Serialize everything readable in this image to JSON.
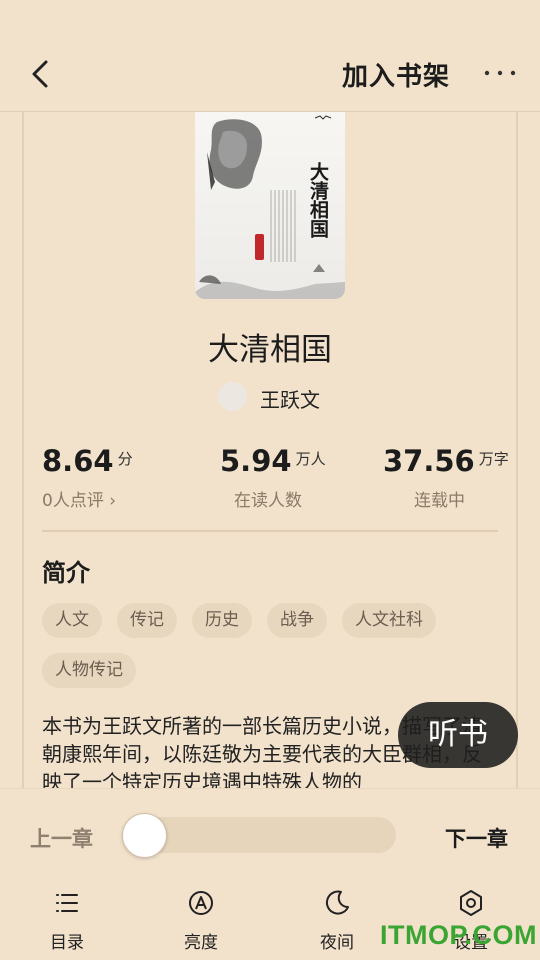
{
  "header": {
    "add_to_shelf": "加入书架"
  },
  "book": {
    "cover_title": "大清相国",
    "title": "大清相国",
    "author": "王跃文"
  },
  "stats": [
    {
      "value": "8.64",
      "unit": "分",
      "label": "0人点评 ›"
    },
    {
      "value": "5.94",
      "unit": "万人",
      "label": "在读人数"
    },
    {
      "value": "37.56",
      "unit": "万字",
      "label": "连载中"
    }
  ],
  "intro": {
    "heading": "简介",
    "tags": [
      "人文",
      "传记",
      "历史",
      "战争",
      "人文社科",
      "人物传记"
    ],
    "description": "本书为王跃文所著的一部长篇历史小说，描写了清朝康熙年间，以陈廷敬为主要代表的大臣群相，反映了一个特定历史境遇中特殊人物的"
  },
  "listen_button": "听书",
  "reader": {
    "prev_chapter": "上一章",
    "next_chapter": "下一章",
    "progress": 0.0,
    "tools": [
      {
        "label": "目录",
        "icon": "list-icon"
      },
      {
        "label": "亮度",
        "icon": "brightness-icon"
      },
      {
        "label": "夜间",
        "icon": "moon-icon"
      },
      {
        "label": "设置",
        "icon": "settings-icon"
      }
    ]
  },
  "watermark": "ITMOP.COM",
  "colors": {
    "background": "#f2e2cb",
    "tag_background": "#e8d7bf",
    "watermark": "#3aa533"
  }
}
